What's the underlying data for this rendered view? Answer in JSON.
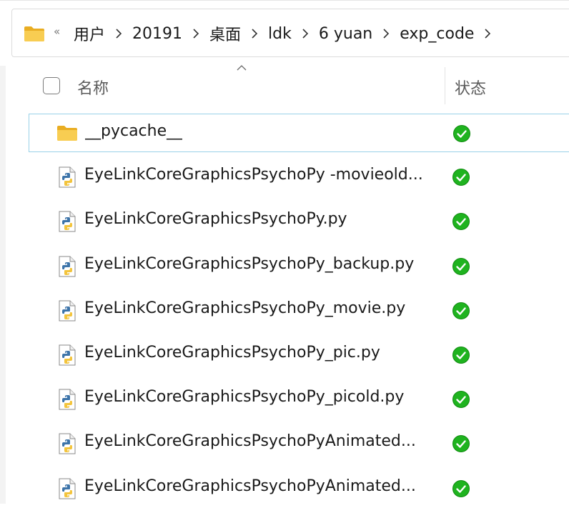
{
  "breadcrumb": {
    "overflow_glyph": "«",
    "items": [
      "用户",
      "20191",
      "桌面",
      "ldk",
      "6 yuan",
      "exp_code"
    ]
  },
  "columns": {
    "name": "名称",
    "status": "状态"
  },
  "files": [
    {
      "name": "__pycache__",
      "type": "folder",
      "status": "synced",
      "selected": true
    },
    {
      "name": "EyeLinkCoreGraphicsPsychoPy -movieold...",
      "type": "python",
      "status": "synced"
    },
    {
      "name": "EyeLinkCoreGraphicsPsychoPy.py",
      "type": "python",
      "status": "synced"
    },
    {
      "name": "EyeLinkCoreGraphicsPsychoPy_backup.py",
      "type": "python",
      "status": "synced"
    },
    {
      "name": "EyeLinkCoreGraphicsPsychoPy_movie.py",
      "type": "python",
      "status": "synced"
    },
    {
      "name": "EyeLinkCoreGraphicsPsychoPy_pic.py",
      "type": "python",
      "status": "synced"
    },
    {
      "name": "EyeLinkCoreGraphicsPsychoPy_picold.py",
      "type": "python",
      "status": "synced"
    },
    {
      "name": "EyeLinkCoreGraphicsPsychoPyAnimated...",
      "type": "python",
      "status": "synced"
    },
    {
      "name": "EyeLinkCoreGraphicsPsychoPyAnimated...",
      "type": "python",
      "status": "synced"
    }
  ],
  "icons": {
    "folder": "folder-icon",
    "python_file": "python-file-icon",
    "status_synced": "check-circle-icon",
    "chevron": "chevron-right-icon",
    "sort": "sort-ascending-icon"
  },
  "colors": {
    "folder": "#f5c242",
    "synced_green": "#1fb31f",
    "selection_border": "#99d1e8",
    "python_blue": "#3d74a9",
    "python_yellow": "#f3c43c"
  }
}
